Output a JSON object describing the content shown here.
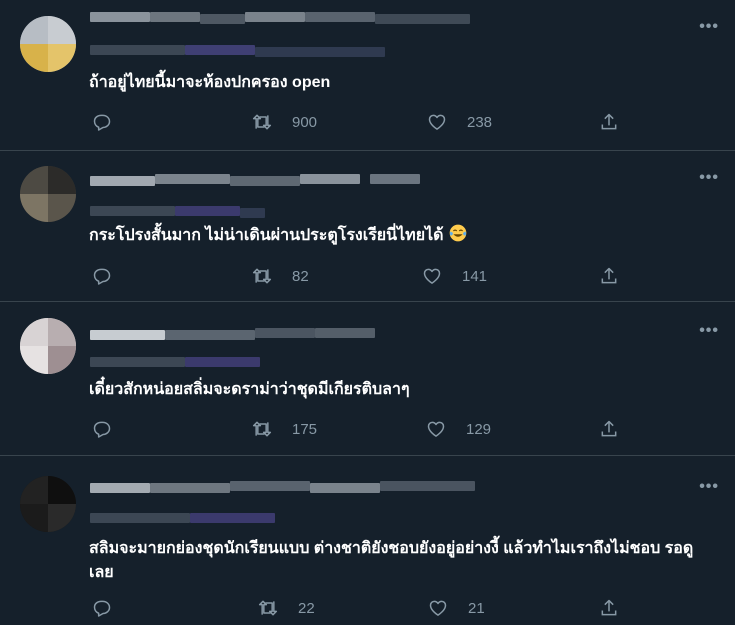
{
  "feed": {
    "more_label": "•••",
    "tweets": [
      {
        "text": "ถ้าอยู่ไทยนี้มาจะห้องปกครอง open",
        "retweets": "900",
        "likes": "238"
      },
      {
        "text": "กระโปรงสั้นมาก ไม่น่าเดินผ่านประตูโรงเรียนี่ไทยได้",
        "emoji": "face-with-tears-of-joy-emoji",
        "retweets": "82",
        "likes": "141"
      },
      {
        "text": "เดี๋ยวสักหน่อยสลิ่มจะดราม่าว่าชุดมีเกียรติบลาๆ",
        "retweets": "175",
        "likes": "129"
      },
      {
        "text": "สลิมจะมายกย่องชุดนักเรียนแบบ ต่างชาติยังชอบยังอยู่อย่างงี้ แล้วทำไมเราถึงไม่ชอบ รอดูเลย",
        "retweets": "22",
        "likes": "21"
      }
    ]
  },
  "icons": {
    "reply": "reply-icon",
    "retweet": "retweet-icon",
    "like": "like-icon",
    "share": "share-icon",
    "more": "more-icon"
  },
  "colors": {
    "background": "#15202b",
    "divider": "#38444d",
    "muted": "#8899a6",
    "text": "#ffffff"
  }
}
